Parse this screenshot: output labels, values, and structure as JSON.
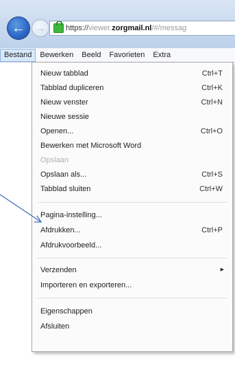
{
  "address_bar": {
    "scheme": "https://",
    "subdomain": "viewer.",
    "domain": "zorgmail.nl",
    "path": "/#/messag"
  },
  "menubar": {
    "items": [
      "Bestand",
      "Bewerken",
      "Beeld",
      "Favorieten",
      "Extra"
    ]
  },
  "file_menu": {
    "items": [
      {
        "label": "Nieuw tabblad",
        "shortcut": "Ctrl+T"
      },
      {
        "label": "Tabblad dupliceren",
        "shortcut": "Ctrl+K"
      },
      {
        "label": "Nieuw venster",
        "shortcut": "Ctrl+N"
      },
      {
        "label": "Nieuwe sessie",
        "shortcut": ""
      },
      {
        "label": "Openen...",
        "shortcut": "Ctrl+O"
      },
      {
        "label": "Bewerken met Microsoft Word",
        "shortcut": ""
      },
      {
        "label": "Opslaan",
        "shortcut": ""
      },
      {
        "label": "Opslaan als...",
        "shortcut": "Ctrl+S"
      },
      {
        "label": "Tabblad sluiten",
        "shortcut": "Ctrl+W"
      },
      {
        "label": "Pagina-instelling...",
        "shortcut": ""
      },
      {
        "label": "Afdrukken...",
        "shortcut": "Ctrl+P"
      },
      {
        "label": "Afdrukvoorbeeld...",
        "shortcut": ""
      },
      {
        "label": "Verzenden",
        "shortcut": ""
      },
      {
        "label": "Importeren en exporteren...",
        "shortcut": ""
      },
      {
        "label": "Eigenschappen",
        "shortcut": ""
      },
      {
        "label": "Afsluiten",
        "shortcut": ""
      }
    ]
  },
  "colors": {
    "arrow": "#3f6fb4",
    "disabled_text": "#b0b0b0"
  },
  "icons": {
    "back": "back-arrow-icon",
    "forward": "forward-arrow-icon",
    "lock": "lock-icon",
    "submenu": "submenu-triangle-icon"
  }
}
